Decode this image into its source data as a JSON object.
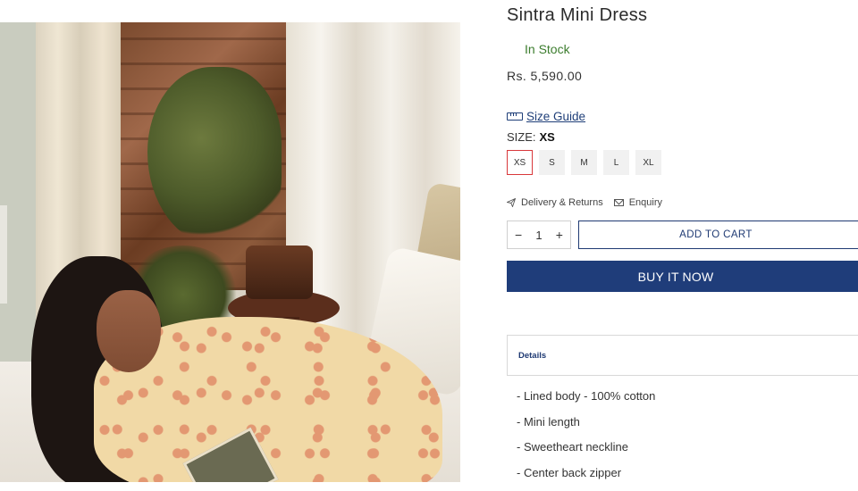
{
  "product": {
    "title": "Sintra Mini Dress",
    "stock_status": "In Stock",
    "price": "Rs. 5,590.00",
    "image_alt_icon": "product-photo"
  },
  "size_guide": {
    "label": "Size Guide",
    "icon": "ruler-icon"
  },
  "size": {
    "label": "SIZE:",
    "selected": "XS",
    "options": [
      "XS",
      "S",
      "M",
      "L",
      "XL"
    ]
  },
  "links": {
    "delivery": "Delivery & Returns",
    "enquiry": "Enquiry"
  },
  "quantity": {
    "minus": "−",
    "value": "1",
    "plus": "+"
  },
  "buttons": {
    "add_to_cart": "ADD TO CART",
    "buy_now": "BUY IT NOW"
  },
  "details": {
    "header": "Details",
    "items": [
      "- Lined body - 100% cotton",
      "- Mini length",
      "- Sweetheart neckline",
      "- Center back zipper"
    ]
  },
  "colors": {
    "accent": "#1f3d7a",
    "in_stock": "#3c7d2e",
    "selected_border": "#d9383b"
  }
}
